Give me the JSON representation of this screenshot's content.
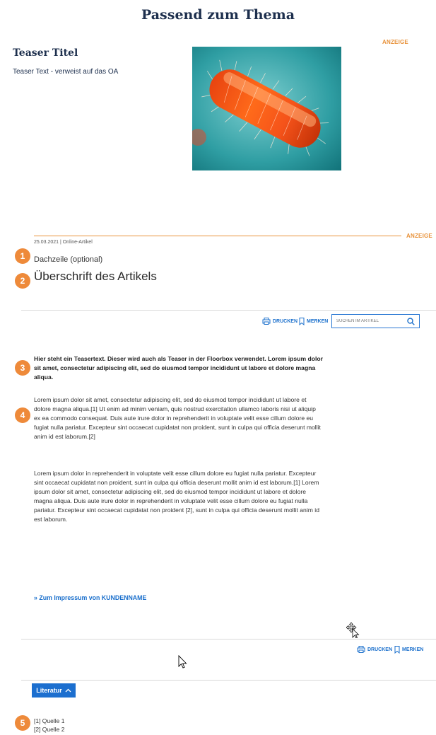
{
  "related": {
    "heading": "Passend zum Thema",
    "anzeige": "ANZEIGE",
    "teaser_title": "Teaser Titel",
    "teaser_text": "Teaser Text - verweist auf das OA",
    "image_icon": "bacterium-image"
  },
  "article": {
    "anzeige": "ANZEIGE",
    "meta": "25.03.2021 | Online-Artikel",
    "dachzeile": "Dachzeile (optional)",
    "headline": "Überschrift des Artikels",
    "markers": [
      "1",
      "2",
      "3",
      "4",
      "5"
    ],
    "toolbar": {
      "print_label": "DRUCKEN",
      "print_icon": "printer-icon",
      "bookmark_label": "MERKEN",
      "bookmark_icon": "bookmark-icon",
      "search_placeholder": "SUCHEN IM ARTIKEL",
      "search_icon": "search-icon"
    },
    "teaser_paragraph": "Hier steht ein Teasertext. Dieser wird auch als Teaser in der Floorbox verwendet. Lorem ipsum dolor sit amet, consectetur adipiscing elit, sed do eiusmod tempor incididunt ut labore et dolore magna aliqua.",
    "body_paragraph_1": "Lorem ipsum dolor sit amet, consectetur adipiscing elit, sed do eiusmod tempor incididunt ut labore et dolore magna aliqua.[1] Ut enim ad minim veniam, quis nostrud exercitation ullamco laboris nisi ut aliquip ex ea commodo consequat. Duis aute irure dolor in reprehenderit in voluptate velit esse cillum dolore eu fugiat nulla pariatur. Excepteur sint occaecat cupidatat non proident, sunt in culpa qui officia deserunt mollit anim id est laborum.[2]",
    "body_paragraph_2": "Lorem ipsum dolor in reprehenderit in voluptate velit esse cillum dolore eu fugiat nulla pariatur. Excepteur sint occaecat cupidatat non proident, sunt in culpa qui officia deserunt mollit anim id est laborum.[1] Lorem ipsum dolor sit amet, consectetur adipiscing elit, sed do eiusmod tempor incididunt ut labore et dolore magna aliqua. Duis aute irure dolor in reprehenderit in voluptate velit esse cillum dolore eu fugiat nulla pariatur. Excepteur sint occaecat cupidatat non proident [2], sunt in culpa qui officia deserunt mollit anim id est laborum.",
    "impressum_link": "» Zum Impressum von KUNDENNAME",
    "bottom_toolbar": {
      "print_label": "DRUCKEN",
      "bookmark_label": "MERKEN"
    },
    "literature": {
      "button_label": "Literatur",
      "chevron_icon": "chevron-up-icon",
      "sources": [
        "[1] Quelle 1",
        "[2] Quelle 2"
      ]
    }
  },
  "colors": {
    "accent_orange": "#ee8a3a",
    "link_blue": "#1a6fcc",
    "heading_navy": "#1d2f4d"
  }
}
